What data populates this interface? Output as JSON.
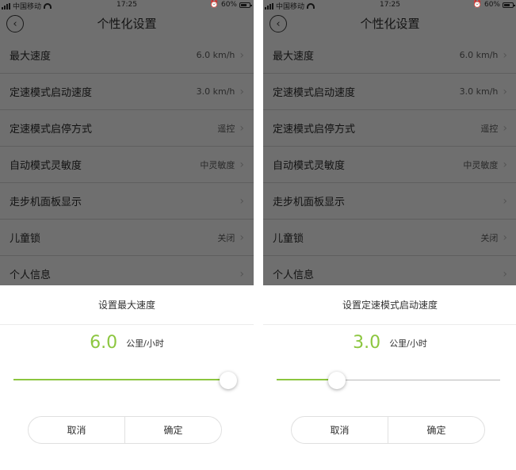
{
  "theme": {
    "accent": "#8cc63f",
    "overlay": "#6f6f6f"
  },
  "screens": [
    {
      "status": {
        "carrier": "中国移动",
        "time": "17:25",
        "battery": "60%"
      },
      "nav": {
        "title": "个性化设置",
        "back_icon": "chevron-left-icon"
      },
      "rows": [
        {
          "label": "最大速度",
          "value": "6.0 km/h"
        },
        {
          "label": "定速模式启动速度",
          "value": "3.0 km/h"
        },
        {
          "label": "定速模式启停方式",
          "value": "遥控"
        },
        {
          "label": "自动模式灵敏度",
          "value": "中灵敏度"
        },
        {
          "label": "走步机面板显示",
          "value": ""
        },
        {
          "label": "儿童锁",
          "value": "关闭"
        },
        {
          "label": "个人信息",
          "value": ""
        }
      ],
      "dialog": {
        "title": "设置最大速度",
        "value": "6.0",
        "unit": "公里/小时",
        "slider_level": 0.96,
        "cancel_label": "取消",
        "confirm_label": "确定"
      }
    },
    {
      "status": {
        "carrier": "中国移动",
        "time": "17:25",
        "battery": "60%"
      },
      "nav": {
        "title": "个性化设置",
        "back_icon": "chevron-left-icon"
      },
      "rows": [
        {
          "label": "最大速度",
          "value": "6.0 km/h"
        },
        {
          "label": "定速模式启动速度",
          "value": "3.0 km/h"
        },
        {
          "label": "定速模式启停方式",
          "value": "遥控"
        },
        {
          "label": "自动模式灵敏度",
          "value": "中灵敏度"
        },
        {
          "label": "走步机面板显示",
          "value": ""
        },
        {
          "label": "儿童锁",
          "value": "关闭"
        },
        {
          "label": "个人信息",
          "value": ""
        }
      ],
      "dialog": {
        "title": "设置定速模式启动速度",
        "value": "3.0",
        "unit": "公里/小时",
        "slider_level": 0.27,
        "cancel_label": "取消",
        "confirm_label": "确定"
      }
    }
  ]
}
